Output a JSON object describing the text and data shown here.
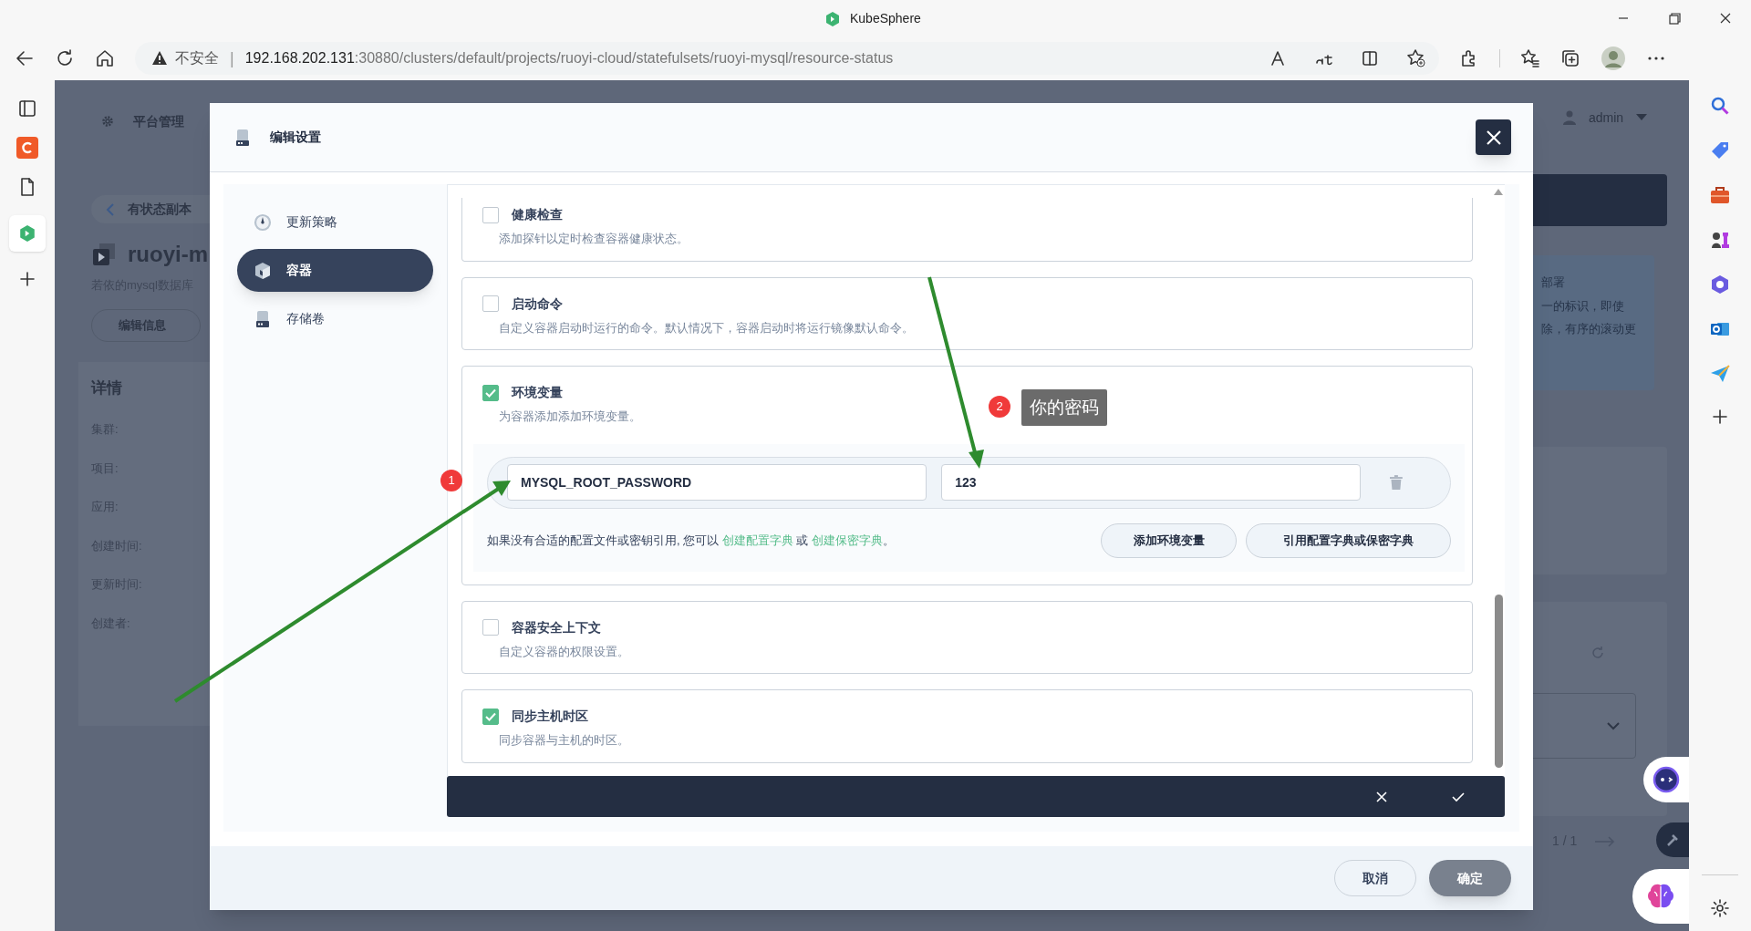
{
  "browser": {
    "title": "KubeSphere",
    "security_label": "不安全",
    "separator": "|",
    "url_host": "192.168.202.131",
    "url_rest": ":30880/clusters/default/projects/ruoyi-cloud/statefulsets/ruoyi-mysql/resource-status"
  },
  "page_behind": {
    "nav_title": "平台管理",
    "user": "admin",
    "breadcrumb": "有状态副本",
    "resource_name": "ruoyi-m",
    "description": "若依的mysql数据库",
    "edit_button": "编辑信息",
    "details_title": "详情",
    "detail_labels": [
      "集群:",
      "项目:",
      "应用:",
      "创建时间:",
      "更新时间:",
      "创建者:"
    ],
    "info_lines": [
      "部署",
      "一的标识，即使",
      "除，有序的滚动更"
    ],
    "pagination": "1 / 1"
  },
  "modal": {
    "title": "编辑设置",
    "nav": [
      {
        "label": "更新策略",
        "selected": false,
        "kind": "gauge"
      },
      {
        "label": "容器",
        "selected": true,
        "kind": "cube"
      },
      {
        "label": "存储卷",
        "selected": false,
        "kind": "disk"
      }
    ],
    "sections": [
      {
        "kind": "basic",
        "title": "健康检查",
        "description": "添加探针以定时检查容器健康状态。",
        "checked": false
      },
      {
        "kind": "basic",
        "title": "启动命令",
        "description": "自定义容器启动时运行的命令。默认情况下，容器启动时将运行镜像默认命令。",
        "checked": false
      },
      {
        "kind": "env",
        "title": "环境变量",
        "description": "为容器添加添加环境变量。",
        "checked": true,
        "env": {
          "name": "MYSQL_ROOT_PASSWORD",
          "value": "123",
          "hint_before": "如果没有合适的配置文件或密钥引用, 您可以 ",
          "link_1": "创建配置字典",
          "hint_middle": " 或 ",
          "link_2": "创建保密字典",
          "hint_after": "。",
          "add_button": "添加环境变量",
          "ref_button": "引用配置字典或保密字典"
        }
      },
      {
        "kind": "basic",
        "title": "容器安全上下文",
        "description": "自定义容器的权限设置。",
        "checked": false
      },
      {
        "kind": "basic",
        "title": "同步主机时区",
        "description": "同步容器与主机的时区。",
        "checked": true
      }
    ],
    "cancel_button": "取消",
    "ok_button": "确定"
  },
  "annotations": {
    "badges": [
      "1",
      "2"
    ],
    "tooltip": "你的密码"
  }
}
